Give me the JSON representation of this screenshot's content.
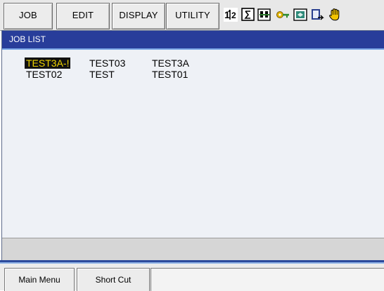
{
  "menu": {
    "job": "JOB",
    "edit": "EDIT",
    "display": "DISPLAY",
    "utility": "UTILITY"
  },
  "status_icons": [
    "axis-toggle-icon",
    "sigma-icon",
    "teach-mode-icon",
    "key-icon",
    "monitor-icon",
    "document-export-icon",
    "hand-hold-icon"
  ],
  "window": {
    "title": "JOB LIST"
  },
  "jobs": [
    {
      "name": "TEST3A-!",
      "selected": true
    },
    {
      "name": "TEST03",
      "selected": false
    },
    {
      "name": "TEST3A",
      "selected": false
    },
    {
      "name": "TEST02",
      "selected": false
    },
    {
      "name": "TEST",
      "selected": false
    },
    {
      "name": "TEST01",
      "selected": false
    }
  ],
  "bottom": {
    "main_menu": "Main Menu",
    "short_cut": "Short Cut"
  },
  "colors": {
    "title_bar": "#283d9a",
    "selection_bg": "#111111",
    "selection_fg": "#f0d400",
    "list_bg": "#eef1f6"
  }
}
